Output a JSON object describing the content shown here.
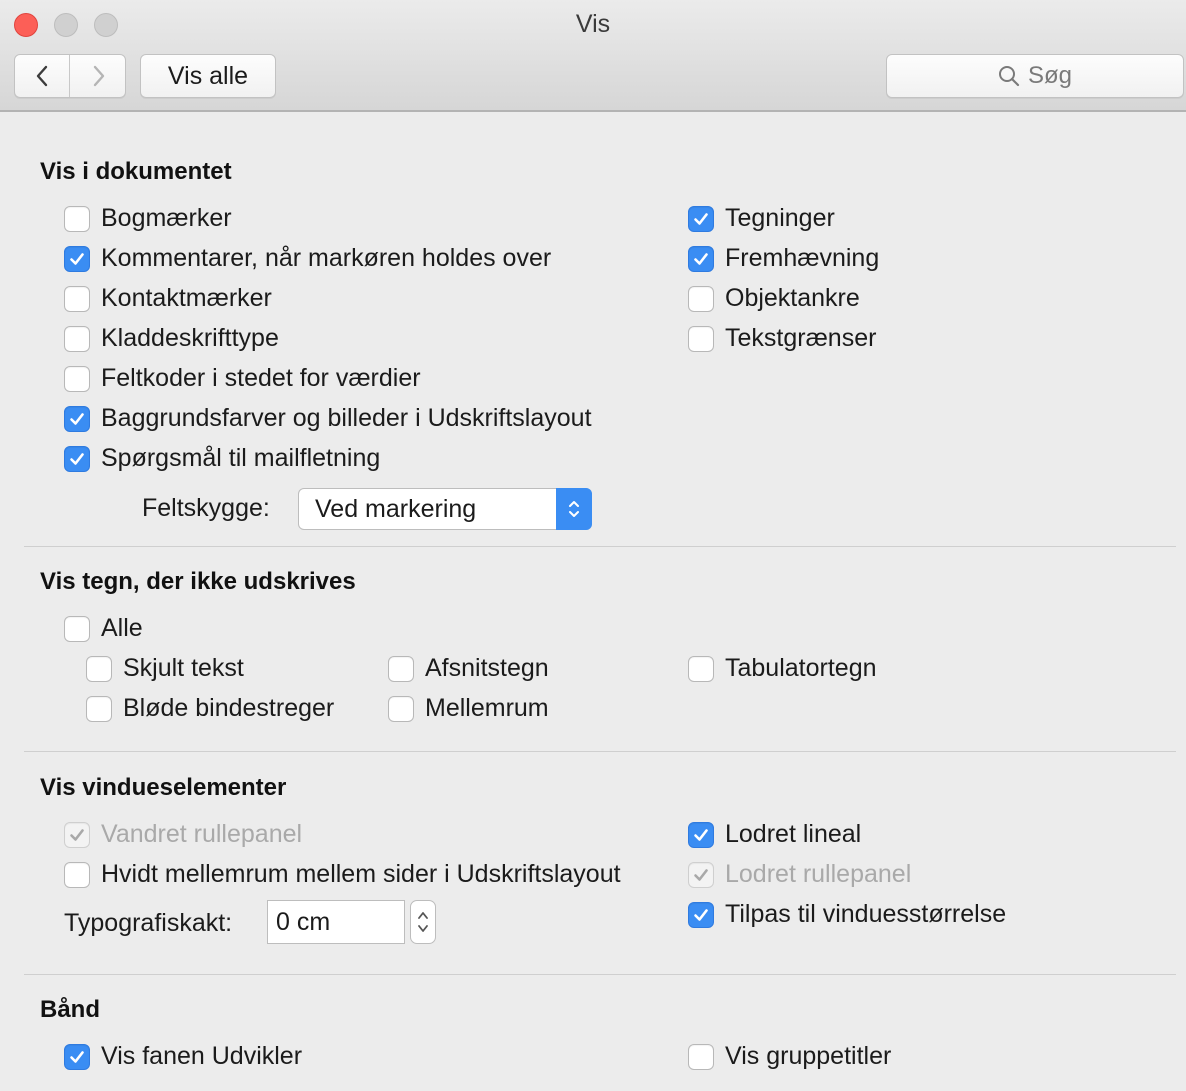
{
  "window": {
    "title": "Vis"
  },
  "toolbar": {
    "show_all_label": "Vis alle",
    "search_placeholder": "Søg"
  },
  "sections": {
    "document": {
      "title": "Vis i dokumentet",
      "left": [
        {
          "label": "Bogmærker",
          "checked": false
        },
        {
          "label": "Kommentarer, når markøren holdes over",
          "checked": true
        },
        {
          "label": "Kontaktmærker",
          "checked": false
        },
        {
          "label": "Kladdeskrifttype",
          "checked": false
        },
        {
          "label": "Feltkoder i stedet for værdier",
          "checked": false
        },
        {
          "label": "Baggrundsfarver og billeder i Udskriftslayout",
          "checked": true
        },
        {
          "label": "Spørgsmål til mailfletning",
          "checked": true
        }
      ],
      "right": [
        {
          "label": "Tegninger",
          "checked": true
        },
        {
          "label": "Fremhævning",
          "checked": true
        },
        {
          "label": "Objektankre",
          "checked": false
        },
        {
          "label": "Tekstgrænser",
          "checked": false
        }
      ],
      "field_shading_label": "Feltskygge:",
      "field_shading_value": "Ved markering"
    },
    "nonprinting": {
      "title": "Vis tegn, der ikke udskrives",
      "all_label": "Alle",
      "all_checked": false,
      "items": [
        {
          "label": "Skjult tekst",
          "checked": false
        },
        {
          "label": "Afsnitstegn",
          "checked": false
        },
        {
          "label": "Tabulatortegn",
          "checked": false
        },
        {
          "label": "Bløde bindestreger",
          "checked": false
        },
        {
          "label": "Mellemrum",
          "checked": false
        }
      ]
    },
    "window": {
      "title": "Vis vindueselementer",
      "left": [
        {
          "label": "Vandret rullepanel",
          "checked": true,
          "disabled": true
        },
        {
          "label": "Hvidt mellemrum mellem sider i Udskriftslayout",
          "checked": false,
          "disabled": false
        }
      ],
      "right": [
        {
          "label": "Lodret lineal",
          "checked": true,
          "disabled": false
        },
        {
          "label": "Lodret rullepanel",
          "checked": true,
          "disabled": true
        },
        {
          "label": "Tilpas til vinduesstørrelse",
          "checked": true,
          "disabled": false
        }
      ],
      "gutter_label": "Typografiskakt:",
      "gutter_value": "0 cm"
    },
    "ribbon": {
      "title": "Bånd",
      "items": [
        {
          "label": "Vis fanen Udvikler",
          "checked": true
        },
        {
          "label": "Vis gruppetitler",
          "checked": false
        }
      ]
    }
  },
  "colors": {
    "accent": "#3a8df3",
    "close": "#fc5f57",
    "background": "#ececec"
  }
}
